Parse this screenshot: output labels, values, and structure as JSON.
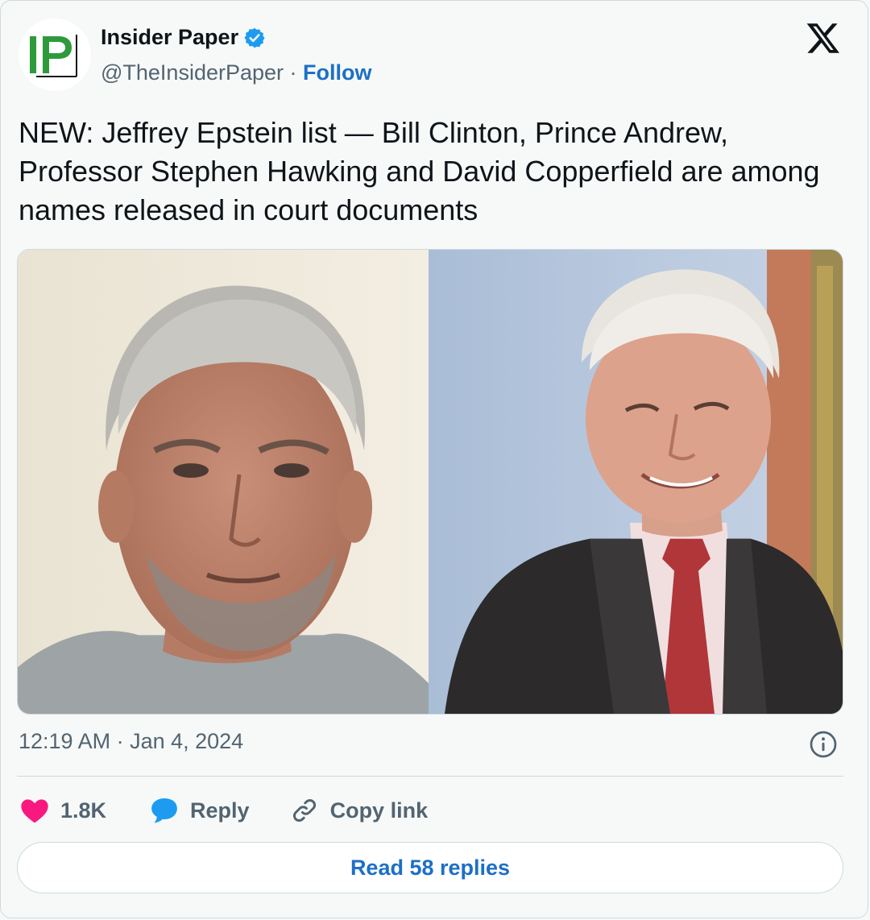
{
  "author": {
    "name": "Insider Paper",
    "handle": "@TheInsiderPaper",
    "separator": "·",
    "follow_label": "Follow",
    "avatar_text": "IP",
    "verified": true
  },
  "tweet": {
    "text": "NEW: Jeffrey Epstein list — Bill Clinton, Prince Andrew, Professor Stephen Hawking and David Copperfield are among names released in court documents",
    "timestamp": "12:19 AM · Jan 4, 2024"
  },
  "actions": {
    "likes_count": "1.8K",
    "reply_label": "Reply",
    "copy_link_label": "Copy link"
  },
  "read_replies_label": "Read 58 replies",
  "icons": [
    "verified-badge-icon",
    "x-logo-icon",
    "info-icon",
    "heart-icon",
    "reply-bubble-icon",
    "link-icon"
  ],
  "colors": {
    "accent_blue": "#1d6fc7",
    "like_red": "#f91880",
    "reply_blue": "#1d9bf0",
    "text_primary": "#0f1419",
    "text_secondary": "#536471",
    "logo_green": "#2e9a3c"
  }
}
